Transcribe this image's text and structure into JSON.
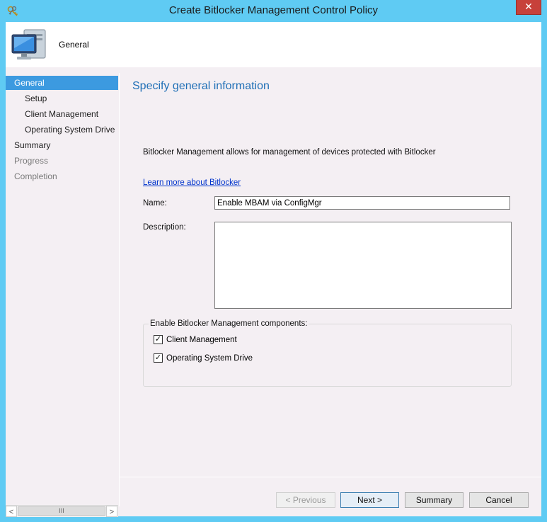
{
  "window": {
    "title": "Create Bitlocker Management Control Policy",
    "close_label": "✕"
  },
  "header": {
    "title": "General"
  },
  "nav": {
    "items": [
      {
        "label": "General",
        "state": "active"
      },
      {
        "label": "Setup",
        "state": "normal"
      },
      {
        "label": "Client Management",
        "state": "normal"
      },
      {
        "label": "Operating System Drive",
        "state": "normal"
      },
      {
        "label": "Summary",
        "state": "normal"
      },
      {
        "label": "Progress",
        "state": "disabled"
      },
      {
        "label": "Completion",
        "state": "disabled"
      }
    ],
    "scroll_left": "<",
    "scroll_right": ">",
    "scroll_grip": "III"
  },
  "main": {
    "page_title": "Specify general information",
    "description": "Bitlocker Management allows for management of devices protected with Bitlocker",
    "learn_more_link": "Learn more about Bitlocker",
    "name_label": "Name:",
    "name_value": "Enable MBAM via ConfigMgr",
    "description_label": "Description:",
    "description_value": "",
    "components_group_label": "Enable Bitlocker Management components:",
    "components": [
      {
        "label": "Client Management",
        "checked": true
      },
      {
        "label": "Operating System Drive",
        "checked": true
      }
    ]
  },
  "buttons": {
    "previous": "< Previous",
    "next": "Next >",
    "summary": "Summary",
    "cancel": "Cancel"
  },
  "colors": {
    "window_frame": "#5fcbf3",
    "nav_active": "#3c9ae0",
    "page_title": "#1f6fb6",
    "close_button": "#c7413a",
    "link": "#0033cc"
  },
  "icons": {
    "title": "keys-icon",
    "header": "computer-monitor-icon"
  }
}
